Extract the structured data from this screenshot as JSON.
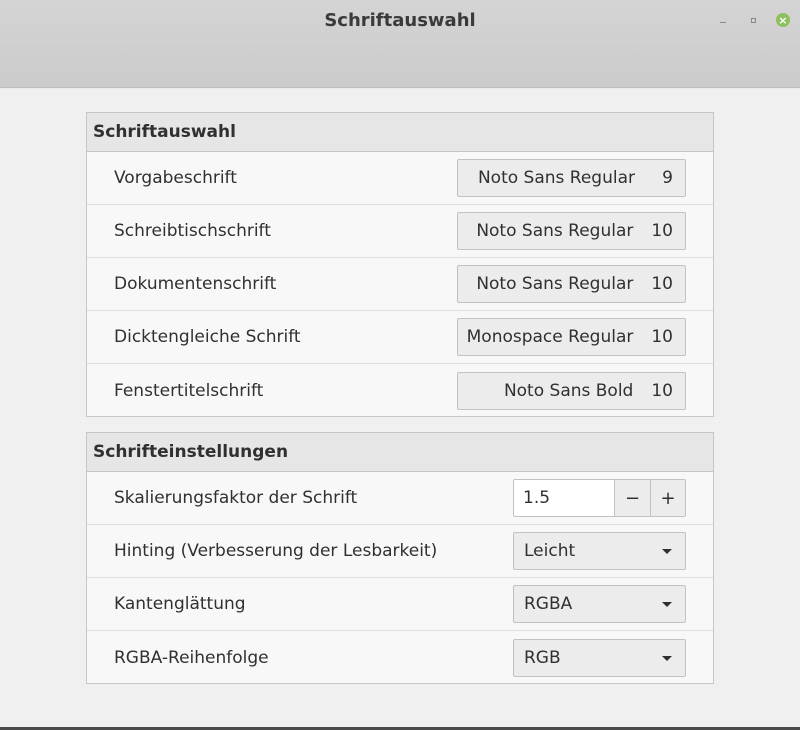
{
  "window": {
    "title": "Schriftauswahl"
  },
  "section_fonts": {
    "header": "Schriftauswahl",
    "rows": [
      {
        "label": "Vorgabeschrift",
        "font": "Noto Sans Regular",
        "size": "9"
      },
      {
        "label": "Schreibtischschrift",
        "font": "Noto Sans Regular",
        "size": "10"
      },
      {
        "label": "Dokumentenschrift",
        "font": "Noto Sans Regular",
        "size": "10"
      },
      {
        "label": "Dicktengleiche Schrift",
        "font": "Monospace Regular",
        "size": "10"
      },
      {
        "label": "Fenstertitelschrift",
        "font": "Noto Sans Bold",
        "size": "10"
      }
    ]
  },
  "section_settings": {
    "header": "Schrifteinstellungen",
    "scaling": {
      "label": "Skalierungsfaktor der Schrift",
      "value": "1.5",
      "minus": "−",
      "plus": "+"
    },
    "hinting": {
      "label": "Hinting (Verbesserung der Lesbarkeit)",
      "value": "Leicht"
    },
    "antialiasing": {
      "label": "Kantenglättung",
      "value": "RGBA"
    },
    "rgba_order": {
      "label": "RGBA-Reihenfolge",
      "value": "RGB"
    }
  },
  "icons": {
    "minimize": "minimize-icon",
    "maximize": "maximize-icon",
    "close": "close-icon",
    "dropdown": "chevron-down-icon"
  },
  "colors": {
    "close_button": "#8fbf5f",
    "titlebar": "#cfcfcf",
    "section_header": "#e6e6e6"
  }
}
